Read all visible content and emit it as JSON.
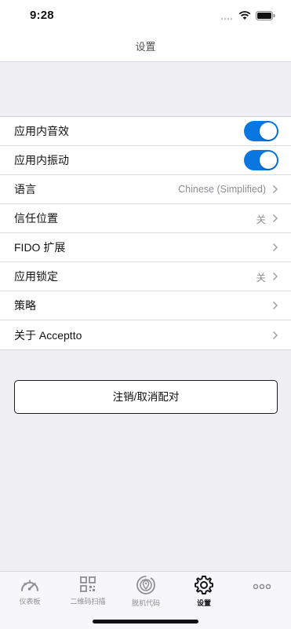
{
  "status_bar": {
    "time": "9:28"
  },
  "nav": {
    "title": "设置"
  },
  "settings": {
    "sound": {
      "label": "应用内音效",
      "enabled": true
    },
    "vibration": {
      "label": "应用内振动",
      "enabled": true
    },
    "language": {
      "label": "语言",
      "value": "Chinese (Simplified)"
    },
    "trusted_location": {
      "label": "信任位置",
      "value": "关"
    },
    "fido": {
      "label": "FIDO 扩展"
    },
    "app_lock": {
      "label": "应用锁定",
      "value": "关"
    },
    "policy": {
      "label": "策略"
    },
    "about": {
      "label": "关于 Acceptto"
    }
  },
  "action": {
    "label": "注销/取消配对"
  },
  "tabs": [
    {
      "label": "仪表板",
      "icon": "dashboard-icon"
    },
    {
      "label": "二维码扫描",
      "icon": "qr-code-icon"
    },
    {
      "label": "脱机代码",
      "icon": "offline-code-icon"
    },
    {
      "label": "设置",
      "icon": "gear-icon",
      "active": true
    },
    {
      "label": "",
      "icon": "more-icon"
    }
  ],
  "colors": {
    "accent": "#0a76e0",
    "background": "#efeff4"
  }
}
